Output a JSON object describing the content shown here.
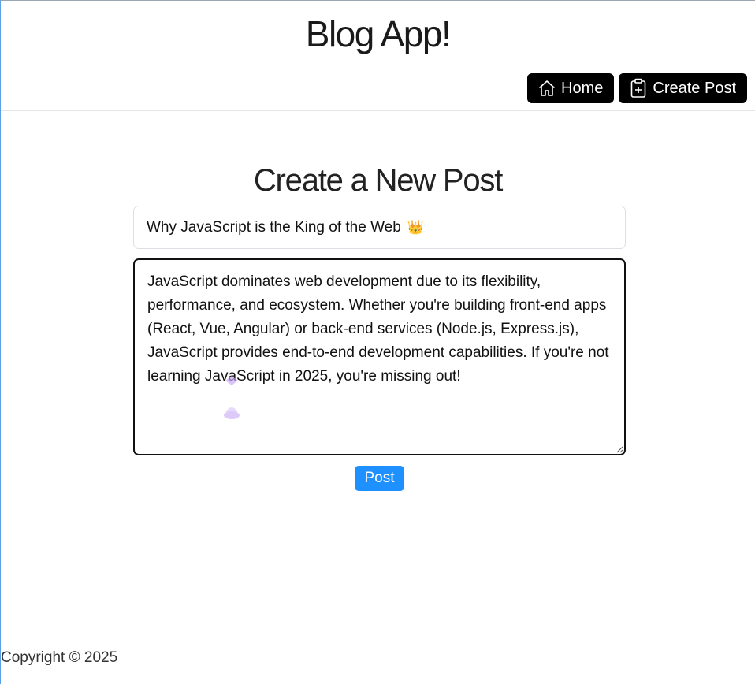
{
  "header": {
    "app_title": "Blog App!",
    "nav": {
      "home_label": "Home",
      "home_icon": "house-icon",
      "create_label": "Create Post",
      "create_icon": "clipboard-plus-icon"
    }
  },
  "form": {
    "heading": "Create a New Post",
    "title_value": "Why JavaScript is the King of the Web",
    "title_emoji": "👑",
    "body_value": "JavaScript dominates web development due to its flexibility, performance, and ecosystem. Whether you're building front-end apps (React, Vue, Angular) or back-end services (Node.js, Express.js), JavaScript provides end-to-end development capabilities. If you're not learning JavaScript in 2025, you're missing out!",
    "submit_label": "Post"
  },
  "footer": {
    "copyright": "Copyright © 2025"
  },
  "colors": {
    "nav_button_bg": "#000000",
    "submit_button_bg": "#1e90ff",
    "text": "#212529"
  }
}
